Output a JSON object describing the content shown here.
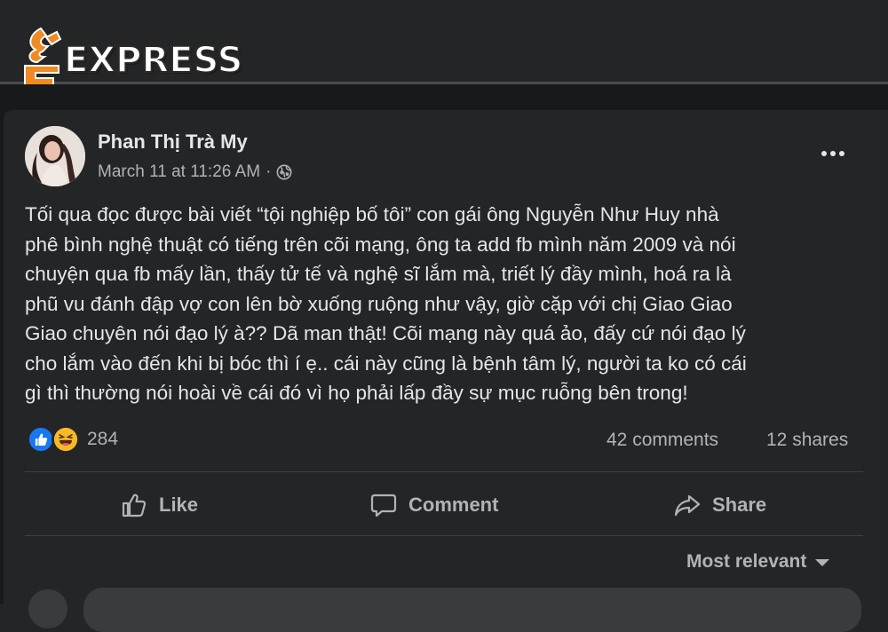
{
  "logo": {
    "text": "EXPRESS",
    "brand_color": "#f08a24"
  },
  "post": {
    "author": "Phan Thị Trà My",
    "timestamp": "March 11 at 11:26 AM",
    "separator": "·",
    "privacy_icon": "globe-icon",
    "more_icon": "more-options-icon",
    "body": "Tối qua đọc được bài viết “tội nghiệp bố tôi” con gái ông Nguyễn Như Huy nhà\nphê bình nghệ thuật có tiếng trên cõi mạng, ông ta add fb mình năm 2009 và nói\nchuyện qua fb mấy lần, thấy tử tế và nghệ sĩ lắm mà, triết lý đầy mình, hoá ra là\nphũ vu đánh đập vợ con lên bờ xuống ruộng như vậy, giờ cặp với chị Giao Giao\nGiao chuyên nói đạo lý à?? Dã man thật! Cõi mạng này quá ảo, đấy cứ nói đạo lý\ncho lắm vào đến khi bị bóc thì í ẹ..  cái này cũng là bệnh tâm lý, người ta ko có cái\ngì thì thường nói hoài về cái đó vì họ phải lấp đầy sự mục ruỗng bên trong!"
  },
  "stats": {
    "reaction_icons": [
      "like-reaction-icon",
      "haha-reaction-icon"
    ],
    "reaction_count": "284",
    "comments": "42 comments",
    "shares": "12 shares"
  },
  "actions": {
    "like": "Like",
    "comment": "Comment",
    "share": "Share"
  },
  "comments_section": {
    "sort_label": "Most relevant"
  },
  "colors": {
    "background": "#18191a",
    "card": "#242526",
    "text_primary": "#e4e6eb",
    "text_secondary": "#b0b3b8",
    "like_blue": "#1877f2",
    "haha_yellow": "#f7b928"
  }
}
